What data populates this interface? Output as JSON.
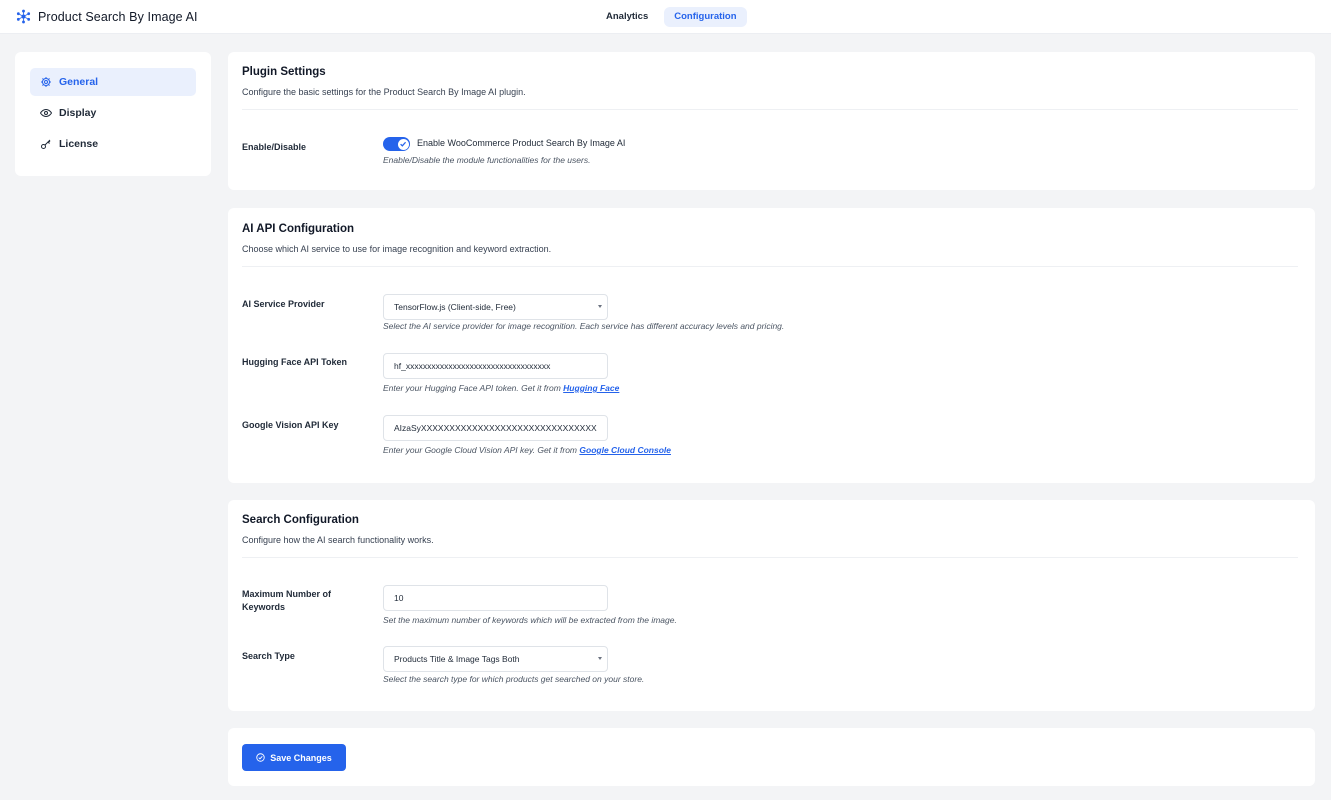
{
  "app": {
    "title": "Product Search By Image AI"
  },
  "top_tabs": [
    {
      "label": "Analytics",
      "active": false
    },
    {
      "label": "Configuration",
      "active": true
    }
  ],
  "sidebar": {
    "items": [
      {
        "label": "General",
        "icon": "gear-icon",
        "active": true
      },
      {
        "label": "Display",
        "icon": "eye-icon",
        "active": false
      },
      {
        "label": "License",
        "icon": "key-icon",
        "active": false
      }
    ]
  },
  "plugin_settings": {
    "title": "Plugin Settings",
    "description": "Configure the basic settings for the Product Search By Image AI plugin.",
    "enable_label": "Enable/Disable",
    "toggle_text": "Enable WooCommerce Product Search By Image AI",
    "toggle_on": true,
    "toggle_hint": "Enable/Disable the module functionalities for the users."
  },
  "ai_api": {
    "title": "AI API Configuration",
    "description": "Choose which AI service to use for image recognition and keyword extraction.",
    "provider_label": "AI Service Provider",
    "provider_value": "TensorFlow.js (Client-side, Free)",
    "provider_hint": "Select the AI service provider for image recognition. Each service has different accuracy levels and pricing.",
    "hf_label": "Hugging Face API Token",
    "hf_value": "hf_xxxxxxxxxxxxxxxxxxxxxxxxxxxxxxxxxx",
    "hf_hint_prefix": "Enter your Hugging Face API token. Get it from",
    "hf_hint_link": "Hugging Face",
    "gv_label": "Google Vision API Key",
    "gv_value": "AIzaSyXXXXXXXXXXXXXXXXXXXXXXXXXXXXXXX",
    "gv_hint_prefix": "Enter your Google Cloud Vision API key. Get it from",
    "gv_hint_link": "Google Cloud Console"
  },
  "search_config": {
    "title": "Search Configuration",
    "description": "Configure how the AI search functionality works.",
    "max_keywords_label": "Maximum Number of Keywords",
    "max_keywords_value": "10",
    "max_keywords_hint": "Set the maximum number of keywords which will be extracted from the image.",
    "search_type_label": "Search Type",
    "search_type_value": "Products Title & Image Tags Both",
    "search_type_hint": "Select the search type for which products get searched on your store."
  },
  "actions": {
    "save_label": "Save Changes"
  },
  "colors": {
    "accent": "#2563eb",
    "accent_light": "#eaf0fd",
    "background": "#f3f4f6"
  }
}
